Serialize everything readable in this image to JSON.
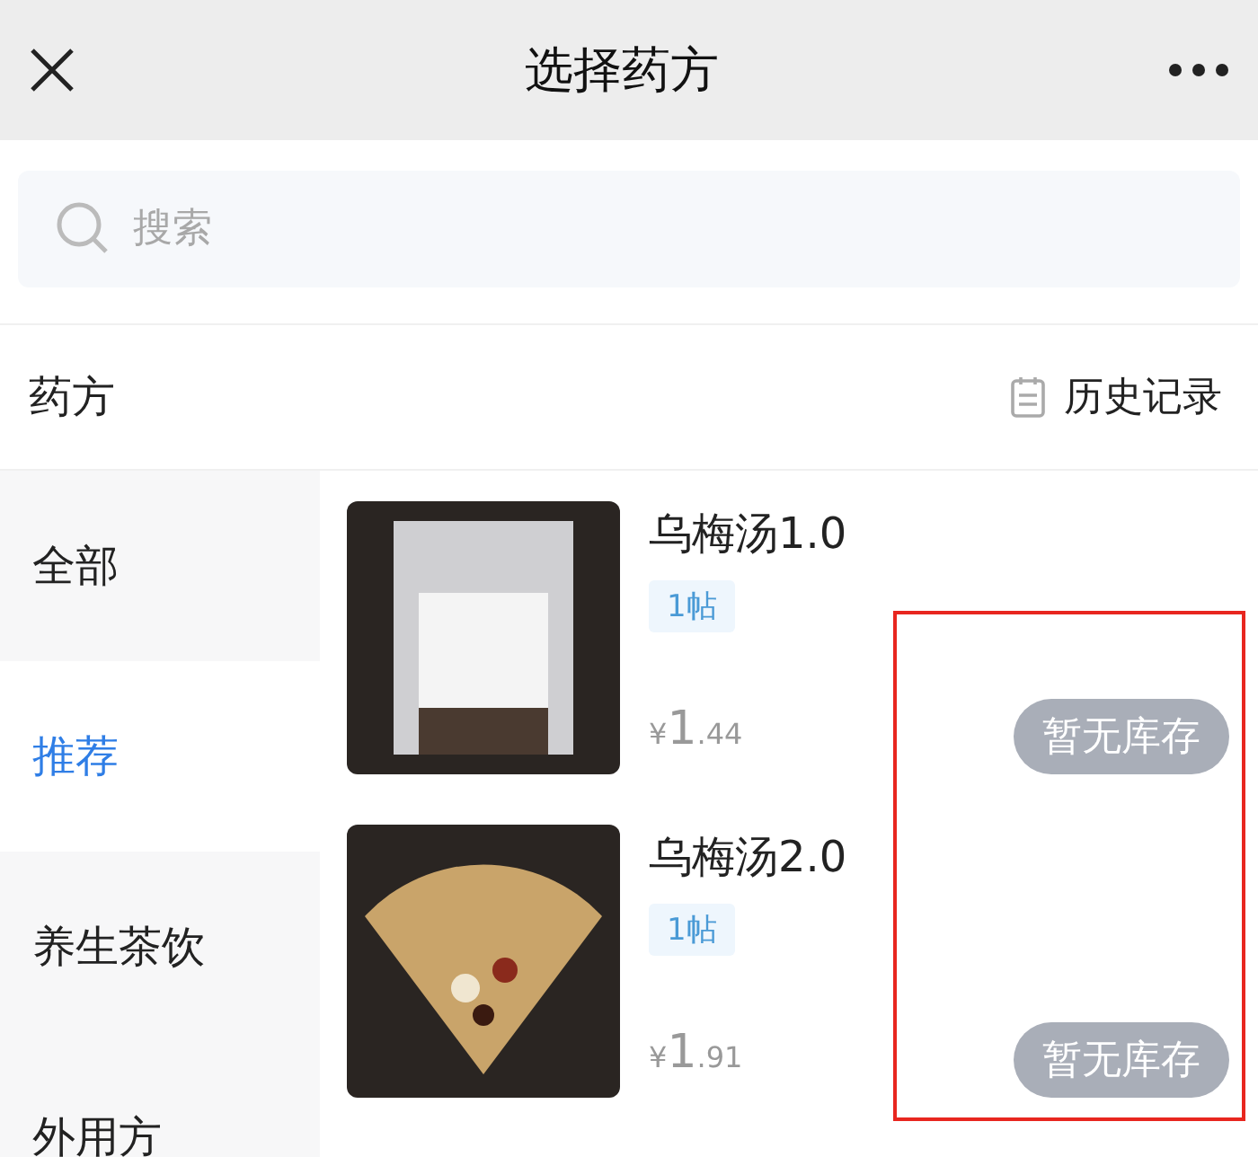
{
  "header": {
    "title": "选择药方"
  },
  "search": {
    "placeholder": "搜索"
  },
  "section": {
    "title": "药方",
    "history": "历史记录"
  },
  "categories": [
    {
      "label": "全部",
      "selected": false
    },
    {
      "label": "推荐",
      "selected": true
    },
    {
      "label": "养生茶饮",
      "selected": false
    },
    {
      "label": "外用方",
      "selected": false
    }
  ],
  "products": [
    {
      "name": "乌梅汤1.0",
      "tag": "1帖",
      "currency": "¥",
      "price_int": "1",
      "price_dec": ".44",
      "button": "暂无库存",
      "in_stock": false
    },
    {
      "name": "乌梅汤2.0",
      "tag": "1帖",
      "currency": "¥",
      "price_int": "1",
      "price_dec": ".91",
      "button": "暂无库存",
      "in_stock": false
    }
  ],
  "highlight": true
}
